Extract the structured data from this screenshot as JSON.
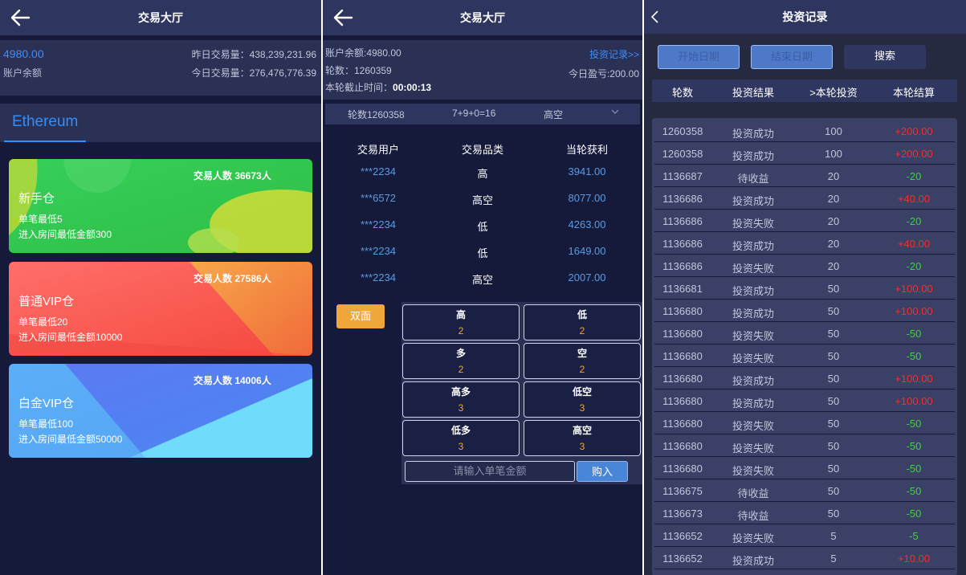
{
  "hall": {
    "title": "交易大厅",
    "balance": "4980.00",
    "balance_label": "账户余额",
    "yesterday_volume": "昨日交易量：438,239,231.96",
    "today_volume": "今日交易量：276,476,776.39",
    "tab": "Ethereum",
    "rooms": [
      {
        "name": "新手仓",
        "count": "交易人数 36673人",
        "min": "单笔最低5",
        "entry": "进入房间最低金额300"
      },
      {
        "name": "普通VIP仓",
        "count": "交易人数 27586人",
        "min": "单笔最低20",
        "entry": "进入房间最低金额10000"
      },
      {
        "name": "白金VIP仓",
        "count": "交易人数 14006人",
        "min": "单笔最低100",
        "entry": "进入房间最低金额50000"
      }
    ]
  },
  "trade": {
    "title": "交易大厅",
    "balance": "账户余额:4980.00",
    "records_link": "投资记录>>",
    "round": "轮数：1260359",
    "today_profit": "今日盈亏:200.00",
    "deadline_label": "本轮截止时间：",
    "deadline": "00:00:13",
    "last_round": "轮数1260358",
    "last_result": "7+9+0=16",
    "last_type": "高空",
    "table_headers": [
      "交易用户",
      "交易品类",
      "当轮获利"
    ],
    "table_rows": [
      [
        "***2234",
        "高",
        "3941.00"
      ],
      [
        "***6572",
        "高空",
        "8077.00"
      ],
      [
        "***2234",
        "低",
        "4263.00"
      ],
      [
        "***2234",
        "低",
        "1649.00"
      ],
      [
        "***2234",
        "高空",
        "2007.00"
      ]
    ],
    "double_button": "双面",
    "options": [
      {
        "name": "高",
        "odds": "2"
      },
      {
        "name": "低",
        "odds": "2"
      },
      {
        "name": "多",
        "odds": "2"
      },
      {
        "name": "空",
        "odds": "2"
      },
      {
        "name": "高多",
        "odds": "3"
      },
      {
        "name": "低空",
        "odds": "3"
      },
      {
        "name": "低多",
        "odds": "3"
      },
      {
        "name": "高空",
        "odds": "3"
      }
    ],
    "amount_placeholder": "请输入单笔金额",
    "buy_button": "购入"
  },
  "records": {
    "title": "投资记录",
    "start_date": "开始日期",
    "end_date": "结束日期",
    "search": "搜索",
    "headers": [
      "轮数",
      "投资结果",
      ">本轮投资",
      "本轮结算"
    ],
    "rows": [
      [
        "1260358",
        "投资成功",
        "100",
        "+200.00"
      ],
      [
        "1260358",
        "投资成功",
        "100",
        "+200.00"
      ],
      [
        "1136687",
        "待收益",
        "20",
        "-20"
      ],
      [
        "1136686",
        "投资成功",
        "20",
        "+40.00"
      ],
      [
        "1136686",
        "投资失败",
        "20",
        "-20"
      ],
      [
        "1136686",
        "投资成功",
        "20",
        "+40.00"
      ],
      [
        "1136686",
        "投资失败",
        "20",
        "-20"
      ],
      [
        "1136681",
        "投资成功",
        "50",
        "+100.00"
      ],
      [
        "1136680",
        "投资成功",
        "50",
        "+100.00"
      ],
      [
        "1136680",
        "投资失败",
        "50",
        "-50"
      ],
      [
        "1136680",
        "投资失败",
        "50",
        "-50"
      ],
      [
        "1136680",
        "投资成功",
        "50",
        "+100.00"
      ],
      [
        "1136680",
        "投资成功",
        "50",
        "+100.00"
      ],
      [
        "1136680",
        "投资失败",
        "50",
        "-50"
      ],
      [
        "1136680",
        "投资失败",
        "50",
        "-50"
      ],
      [
        "1136680",
        "投资失败",
        "50",
        "-50"
      ],
      [
        "1136675",
        "待收益",
        "50",
        "-50"
      ],
      [
        "1136673",
        "待收益",
        "50",
        "-50"
      ],
      [
        "1136652",
        "投资失败",
        "5",
        "-5"
      ],
      [
        "1136652",
        "投资成功",
        "5",
        "+10.00"
      ]
    ]
  },
  "colors": {
    "background": "#151a3b",
    "header": "#2e3660",
    "accent": "#3d8dff",
    "profit": "#ff2a2a",
    "loss": "#3ed33e",
    "odds": "#f0a73a"
  }
}
